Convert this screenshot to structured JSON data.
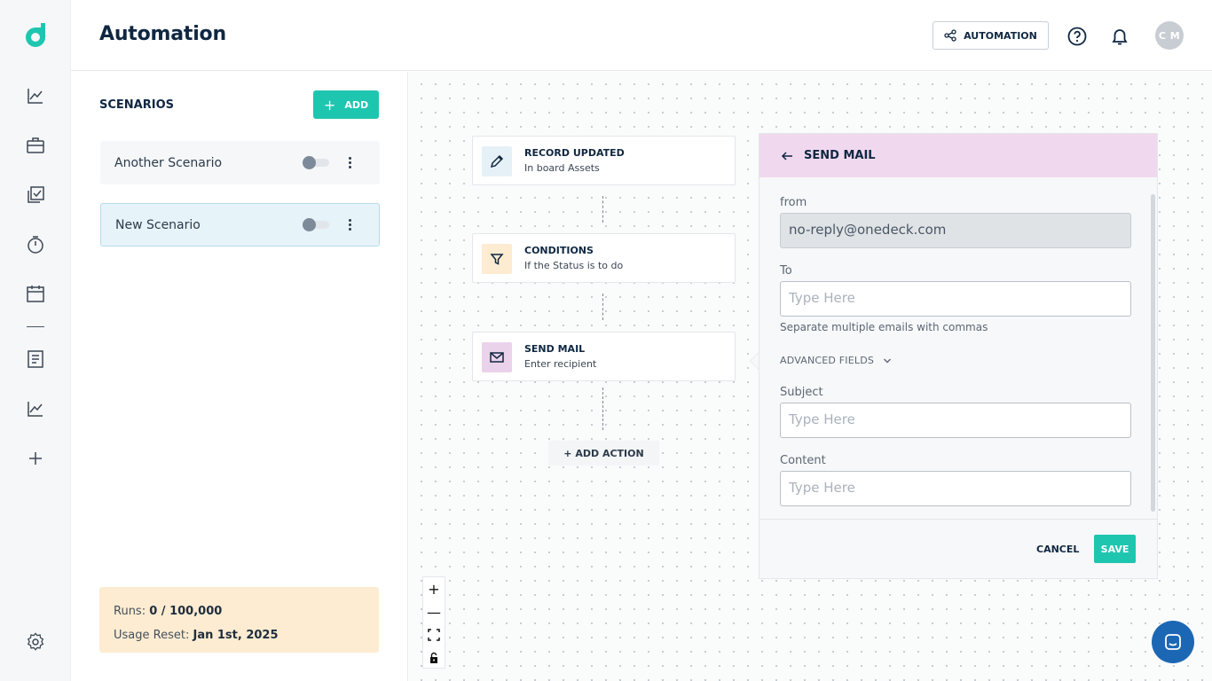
{
  "header": {
    "title": "Automation",
    "automation_button": "AUTOMATION",
    "avatar_initials": "C M"
  },
  "sidebar": {
    "icons": [
      "logo-icon",
      "analytics-icon",
      "briefcase-icon",
      "tasks-icon",
      "timer-icon",
      "calendar-icon",
      "document-icon",
      "chart-icon",
      "add-icon",
      "settings-icon"
    ]
  },
  "scenarios": {
    "title": "SCENARIOS",
    "add_label": "ADD",
    "items": [
      {
        "name": "Another Scenario",
        "enabled": false
      },
      {
        "name": "New Scenario",
        "enabled": false,
        "selected": true
      }
    ],
    "usage": {
      "runs_label": "Runs:",
      "runs_value": "0 / 100,000",
      "reset_label": "Usage Reset:",
      "reset_value": "Jan 1st, 2025"
    }
  },
  "flow": {
    "nodes": [
      {
        "title": "RECORD UPDATED",
        "subtitle": "In board Assets",
        "icon": "pencil-icon"
      },
      {
        "title": "CONDITIONS",
        "subtitle": "If the Status is to do",
        "icon": "filter-icon"
      },
      {
        "title": "SEND MAIL",
        "subtitle": "Enter recipient",
        "icon": "mail-icon"
      }
    ],
    "add_action_label": "+ ADD ACTION",
    "zoom_controls": [
      "+",
      "—"
    ]
  },
  "send_mail": {
    "title": "SEND MAIL",
    "from_label": "from",
    "from_value": "no-reply@onedeck.com",
    "to_label": "To",
    "to_placeholder": "Type Here",
    "to_hint": "Separate multiple emails with commas",
    "advanced_label": "ADVANCED FIELDS",
    "subject_label": "Subject",
    "subject_placeholder": "Type Here",
    "content_label": "Content",
    "content_placeholder": "Type Here",
    "cancel_label": "CANCEL",
    "save_label": "SAVE"
  },
  "colors": {
    "accent": "#1ec6b0",
    "drawer_header": "#f0d9ef",
    "chat": "#1c67b4",
    "usage_bg": "#fdecd1"
  }
}
